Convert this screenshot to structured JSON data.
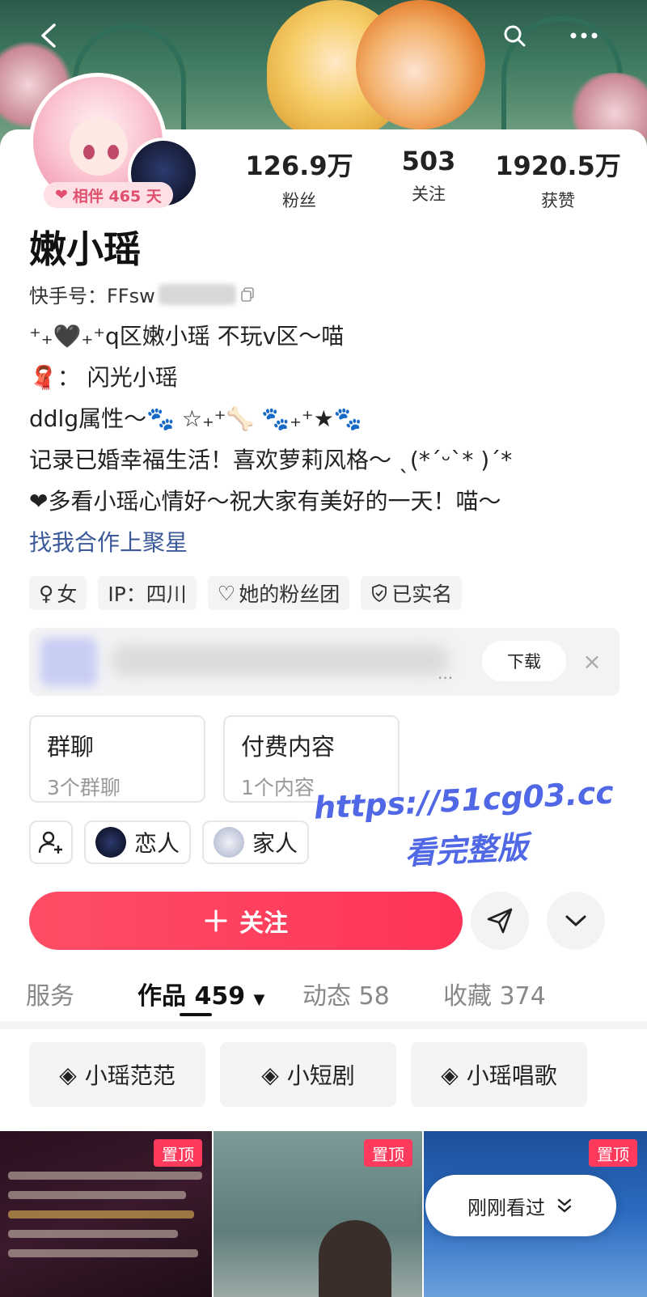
{
  "nav": {
    "back_icon": "chevron-left-icon",
    "search_icon": "search-icon",
    "more_icon": "more-dots-icon"
  },
  "profile": {
    "companion_badge": "相伴 465 天",
    "name": "嫩小瑶",
    "kuaishou_id_label": "快手号：FFsw",
    "stats": [
      {
        "value": "126.9万",
        "label": "粉丝"
      },
      {
        "value": "503",
        "label": "关注"
      },
      {
        "value": "1920.5万",
        "label": "获赞"
      }
    ],
    "bio_lines": [
      "⁺₊🖤₊⁺q区嫩小瑶 不玩v区～喵",
      "🧣：  闪光小瑶",
      "ddlg属性～🐾  ☆₊⁺🦴 🐾₊⁺★🐾",
      "记录已婚幸福生活！喜欢萝莉风格～ ˎ(*ˊᵕˋ* )ˊ*",
      "❤多看小瑶心情好～祝大家有美好的一天！喵～"
    ],
    "cooperation_link": "找我合作上聚星",
    "tags": [
      "女",
      "IP：四川",
      "她的粉丝团",
      "已实名"
    ]
  },
  "ad": {
    "download_label": "下载",
    "dots": "..."
  },
  "cards": [
    {
      "title": "群聊",
      "sub": "3个群聊"
    },
    {
      "title": "付费内容",
      "sub": "1个内容"
    }
  ],
  "relations": [
    "恋人",
    "家人"
  ],
  "actions": {
    "follow_label": "关注"
  },
  "tabs": [
    {
      "label": "服务"
    },
    {
      "label": "作品 459"
    },
    {
      "label": "动态 58"
    },
    {
      "label": "收藏 374"
    }
  ],
  "collections": [
    "小瑶范范",
    "小短剧",
    "小瑶唱歌"
  ],
  "thumbs": {
    "pin_label": "置顶"
  },
  "recent_label": "刚刚看过",
  "watermark": {
    "line1": "https://51cg03.cc",
    "line2": "看完整版"
  },
  "colors": {
    "accent": "#fe3b5c",
    "link": "#3c5a9a",
    "badge_bg": "#fde0e6"
  }
}
